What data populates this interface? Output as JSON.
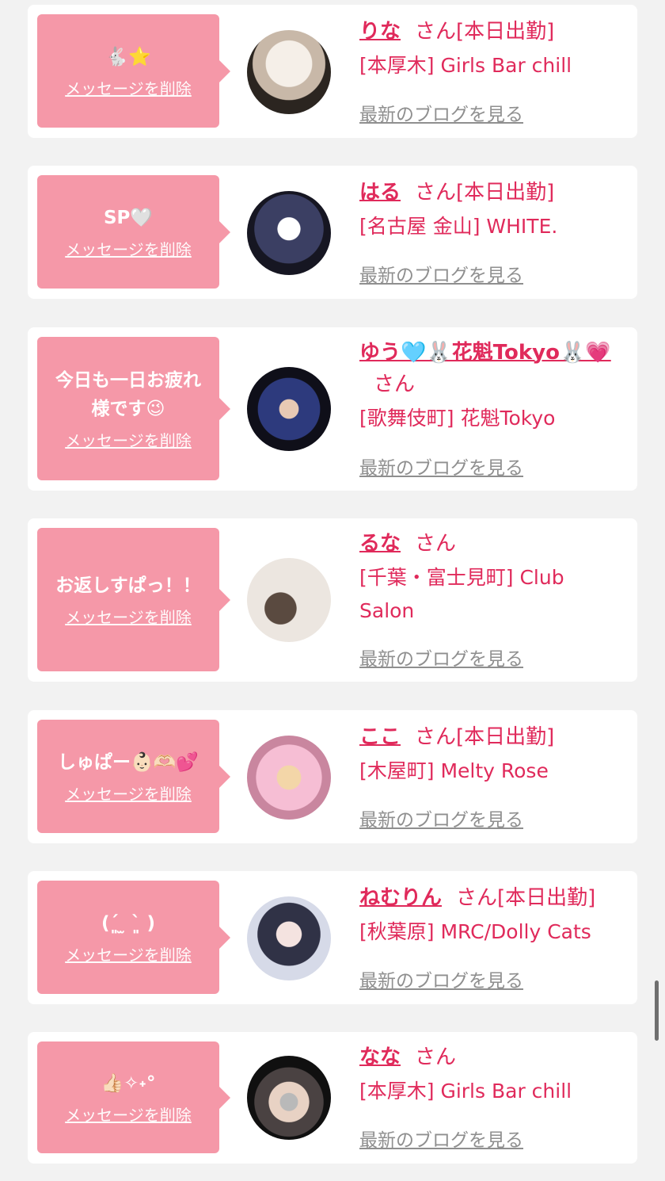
{
  "delete_label": "メッセージを削除",
  "blog_label": "最新のブログを見る",
  "san_label": "さん",
  "colors": {
    "accent": "#e02a5b",
    "bubble": "#f598a8",
    "background": "#f2f2f2"
  },
  "cards": [
    {
      "message": "🐇⭐",
      "name": "りな",
      "work_status": "[本日出勤]",
      "shop": "[本厚木] Girls Bar chill",
      "avatar_colors": [
        "#f5efe8",
        "#2b2520"
      ]
    },
    {
      "message": "SP🤍",
      "name": "はる",
      "work_status": "[本日出勤]",
      "shop": "[名古屋 金山] WHITE.",
      "avatar_colors": [
        "#3b3f63",
        "#161622"
      ]
    },
    {
      "message": "今日も一日お疲れ様です😉",
      "name": "ゆう🩵🐰花魁Tokyo🐰💗",
      "work_status": "",
      "shop": "[歌舞伎町] 花魁Tokyo",
      "avatar_colors": [
        "#2d3a7d",
        "#0f0f19"
      ]
    },
    {
      "message": "お返しすぱっ！！",
      "name": "るな",
      "work_status": "",
      "shop": "[千葉・富士見町] Club Salon",
      "avatar_colors": [
        "#ece6e0",
        "#5a4a40"
      ]
    },
    {
      "message": "しゅぱー👶🏻🫶🏻💕",
      "name": "ここ",
      "work_status": "[本日出勤]",
      "shop": "[木屋町] Melty Rose",
      "avatar_colors": [
        "#f6bed4",
        "#c9869f"
      ]
    },
    {
      "message": "(ˊ͈ ̫ ˋ͈ )",
      "name": "ねむりん",
      "work_status": "[本日出勤]",
      "shop": "[秋葉原] MRC/Dolly Cats",
      "avatar_colors": [
        "#d6dae8",
        "#303246"
      ]
    },
    {
      "message": "👍🏻✧˖°",
      "name": "なな",
      "work_status": "",
      "shop": "[本厚木] Girls Bar chill",
      "avatar_colors": [
        "#4a4242",
        "#101010"
      ]
    }
  ]
}
